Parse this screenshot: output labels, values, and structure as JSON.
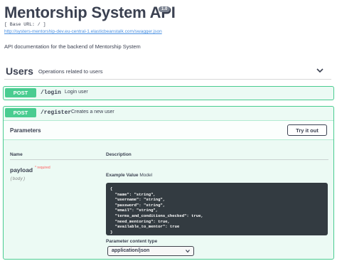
{
  "header": {
    "title": "Mentorship System API",
    "version": "1.0",
    "base_url": "[ Base URL: / ]",
    "swagger_link": "http://systers-mentorship-dev.eu-central-1.elasticbeanstalk.com/swagger.json",
    "description": "API documentation for the backend of Mentorship System"
  },
  "tag": {
    "name": "Users",
    "description": "Operations related to users"
  },
  "operations": [
    {
      "method": "POST",
      "path": "/login",
      "summary": "Login user"
    },
    {
      "method": "POST",
      "path": "/register",
      "summary": "Creates a new user"
    }
  ],
  "parameters_section": {
    "title": "Parameters",
    "try_button": "Try it out",
    "col_name": "Name",
    "col_description": "Description"
  },
  "param": {
    "name": "payload",
    "required_mark": "* required",
    "location": "(body)",
    "example_tab": "Example Value",
    "model_tab": "Model",
    "example_lines": [
      "{",
      "  \"name\": \"string\",",
      "  \"username\": \"string\",",
      "  \"password\": \"string\",",
      "  \"email\": \"string\",",
      "  \"terms_and_conditions_checked\": true,",
      "  \"need_mentoring\": true,",
      "  \"available_to_mentor\": true",
      "}"
    ],
    "content_type_label": "Parameter content type",
    "content_type_value": "application/json"
  },
  "colors": {
    "post_green": "#49cc90",
    "code_bg": "#333b41",
    "link_blue": "#4990e2",
    "required_red": "#ff6060"
  },
  "icons": {
    "tag_toggle": "chevron-down-icon",
    "select_caret": "caret-down-icon"
  }
}
